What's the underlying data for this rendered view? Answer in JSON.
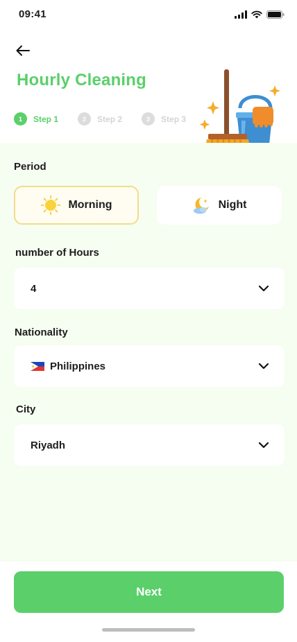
{
  "status_bar": {
    "time": "09:41"
  },
  "header": {
    "title": "Hourly Cleaning"
  },
  "stepper": {
    "steps": [
      {
        "number": "1",
        "label": "Step 1"
      },
      {
        "number": "2",
        "label": "Step 2"
      },
      {
        "number": "3",
        "label": "Step 3"
      }
    ],
    "active_step": 1
  },
  "period": {
    "label": "Period",
    "options": [
      {
        "label": "Morning",
        "icon": "sun-icon"
      },
      {
        "label": "Night",
        "icon": "moon-icon"
      }
    ],
    "selected": "Morning"
  },
  "hours": {
    "label": "number of Hours",
    "value": "4"
  },
  "nationality": {
    "label": "Nationality",
    "value": "Philippines",
    "flag_icon": "philippines-flag-icon"
  },
  "city": {
    "label": "City",
    "value": "Riyadh"
  },
  "footer": {
    "next_label": "Next"
  },
  "colors": {
    "accent": "#5bcf6a",
    "content_background": "#f6fdf1",
    "selected_border": "#f2dc8a",
    "inactive_step": "#dcdcdc"
  }
}
